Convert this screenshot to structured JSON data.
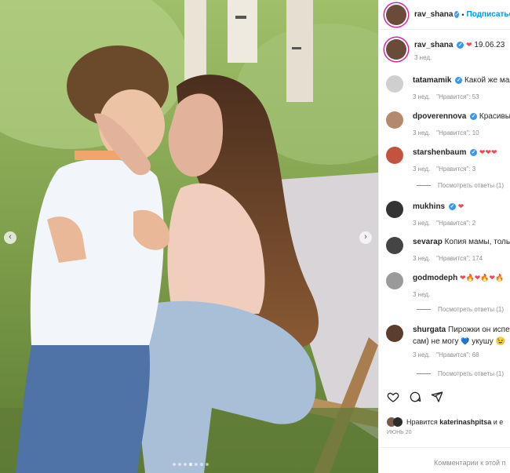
{
  "post": {
    "author": "rav_shana",
    "follow_label": "Подписаться",
    "separator": "•",
    "caption_text": "19.06.23",
    "caption_time": "3 нед."
  },
  "comments": [
    {
      "user": "tatamamik",
      "text": "Какой же мамин",
      "time": "3 нед.",
      "likes": "\"Нравится\": 53"
    },
    {
      "user": "dpoverennova",
      "text": "Красивые!!",
      "time": "3 нед.",
      "likes": "\"Нравится\": 10"
    },
    {
      "user": "starshenbaum",
      "text": "",
      "time": "3 нед.",
      "likes": "\"Нравится\": 3",
      "replies": "Посмотреть ответы (1)"
    },
    {
      "user": "mukhins",
      "text": "",
      "time": "3 нед.",
      "likes": "\"Нравится\": 2"
    },
    {
      "user": "sevarap",
      "text": "Копия мамы, только",
      "time": "3 нед.",
      "likes": "\"Нравится\": 174"
    },
    {
      "user": "godmodeph",
      "text": "",
      "time": "3 нед.",
      "likes": "",
      "replies": "Посмотреть ответы (1)"
    },
    {
      "user": "shurgata",
      "text": "Пирожки он испеч",
      "text2": "сам) не могу",
      "text3": "укушу",
      "time": "3 нед.",
      "likes": "\"Нравится\": 68",
      "replies": "Посмотреть ответы (1)"
    }
  ],
  "likes_line": {
    "prefix": "Нравится",
    "user": "katerinashpitsa",
    "suffix": "и e"
  },
  "post_date": "ИЮНЬ 20",
  "add_comment_placeholder": "Комментарии к этой п",
  "carousel": {
    "count": 7,
    "active": 3
  },
  "icons": [
    "chevron-left-icon",
    "chevron-right-icon",
    "heart-icon",
    "comment-icon",
    "share-icon",
    "verified-icon"
  ],
  "colors": {
    "accent": "#0095f6",
    "verified": "#3897f0",
    "heart": "#ed4956"
  }
}
